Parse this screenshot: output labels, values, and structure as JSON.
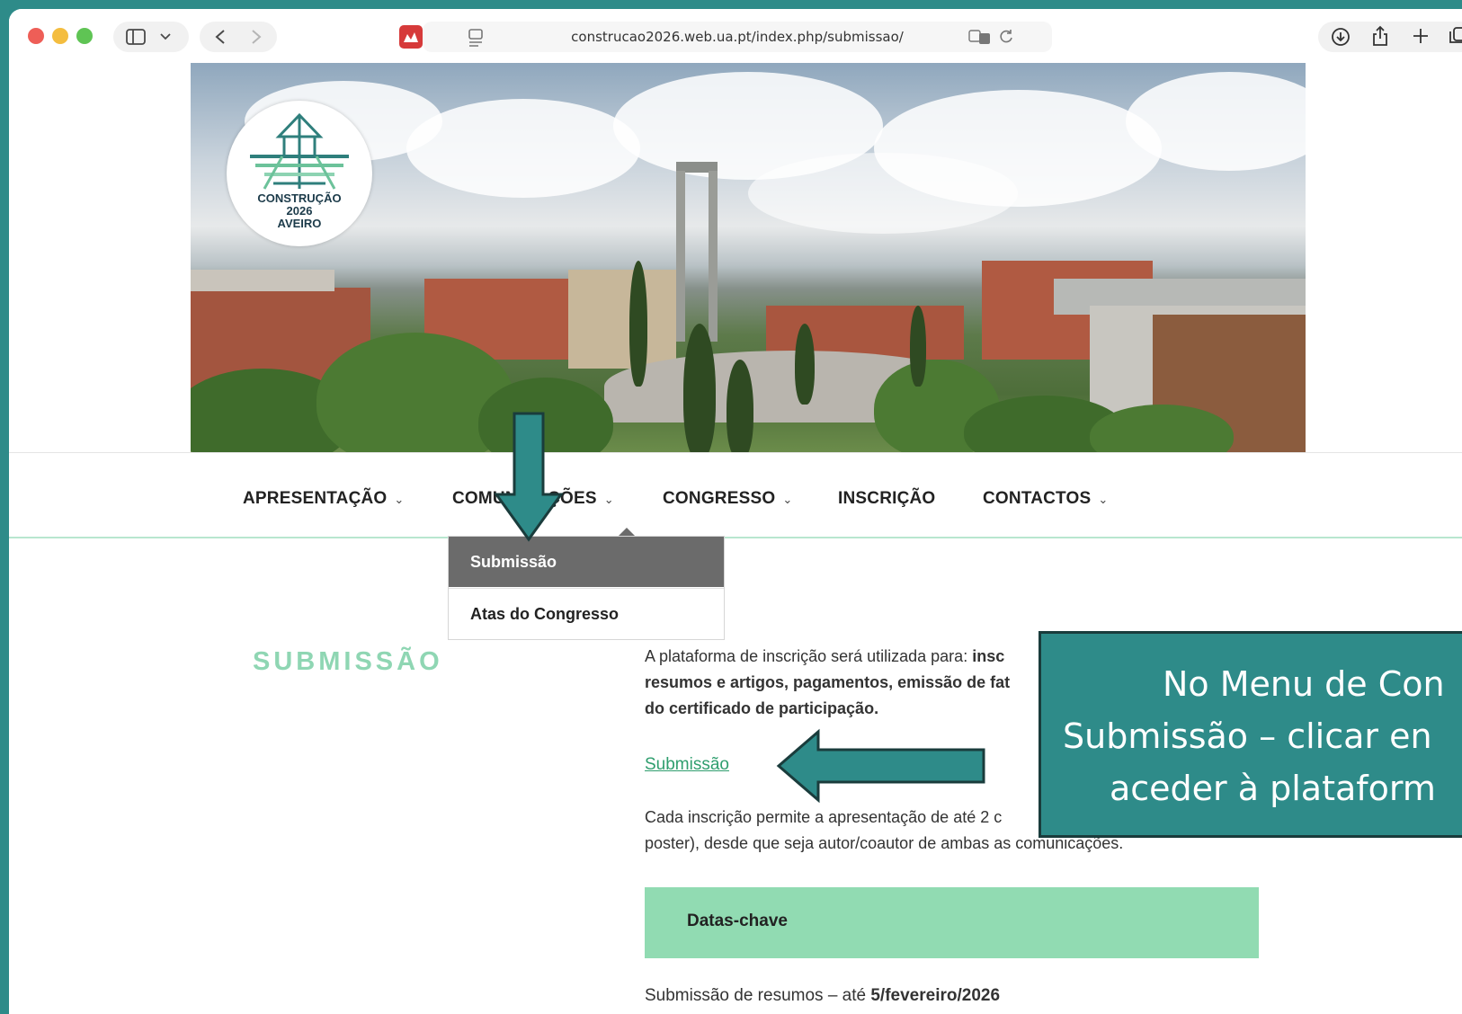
{
  "browser": {
    "url": "construcao2026.web.ua.pt/index.php/submissao/"
  },
  "logo": {
    "line1": "CONSTRUÇÃO",
    "line2": "2026",
    "line3": "AVEIRO"
  },
  "nav": {
    "items": [
      {
        "label": "APRESENTAÇÃO",
        "has_dropdown": true
      },
      {
        "label": "COMUNICAÇÕES",
        "has_dropdown": true
      },
      {
        "label": "CONGRESSO",
        "has_dropdown": true
      },
      {
        "label": "INSCRIÇÃO",
        "has_dropdown": false
      },
      {
        "label": "CONTACTOS",
        "has_dropdown": true
      }
    ],
    "dropdown": {
      "items": [
        "Submissão",
        "Atas do Congresso"
      ],
      "active_index": 0
    }
  },
  "page": {
    "title": "SUBMISSÃO",
    "intro_line1_plain": "A plataforma de inscrição será utilizada para: ",
    "intro_line1_bold": "insc",
    "intro_line2_bold": "resumos e artigos, pagamentos, emissão de fat",
    "intro_line3_bold": "do certificado de participação.",
    "submission_link": "Submissão",
    "para2_line1": "Cada inscrição permite a apresentação de até 2 c",
    "para2_line2": "poster), desde que seja autor/coautor de ambas as comunicações.",
    "key_dates_label": "Datas-chave",
    "date_line_plain": "Submissão de resumos – até ",
    "date_line_bold": "5/fevereiro/2026"
  },
  "annotation": {
    "line1": "No Menu de Con",
    "line2": "Submissão –  clicar en",
    "line3": "aceder à plataform"
  },
  "colors": {
    "accent_green": "#91dbb2",
    "title_green": "#8fd6b3",
    "annotation_teal": "#2e8b89"
  }
}
